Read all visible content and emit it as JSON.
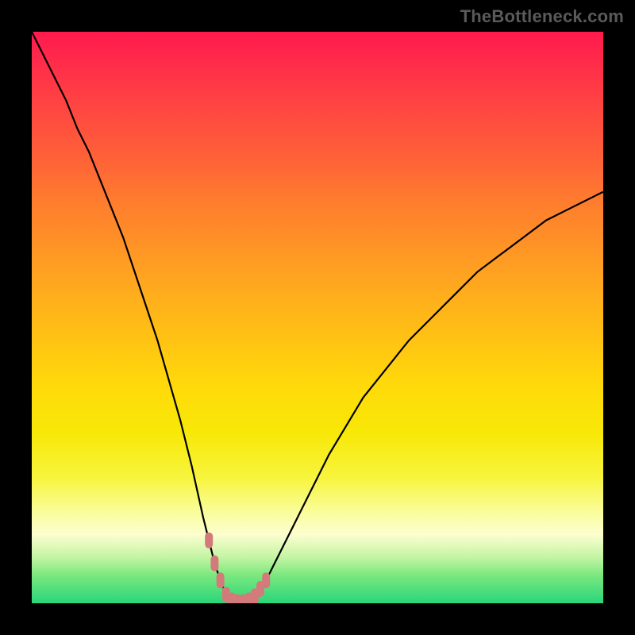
{
  "watermark": "TheBottleneck.com",
  "chart_data": {
    "type": "line",
    "title": "",
    "xlabel": "",
    "ylabel": "",
    "xlim": [
      0,
      100
    ],
    "ylim": [
      0,
      100
    ],
    "description": "Bottleneck percentage curve with a V-shaped minimum near x≈36, on a rainbow gradient (red=high bottleneck at top, green=low at bottom).",
    "series": [
      {
        "name": "bottleneck-curve",
        "x": [
          0,
          2,
          4,
          6,
          8,
          10,
          12,
          14,
          16,
          18,
          20,
          22,
          24,
          26,
          28,
          30,
          31,
          32,
          33,
          34,
          35,
          36,
          37,
          38,
          39,
          40,
          41,
          42,
          44,
          46,
          48,
          50,
          52,
          55,
          58,
          62,
          66,
          70,
          74,
          78,
          82,
          86,
          90,
          94,
          98,
          100
        ],
        "y": [
          100,
          96,
          92,
          88,
          83,
          79,
          74,
          69,
          64,
          58,
          52,
          46,
          39,
          32,
          24,
          15,
          11,
          7,
          4,
          1.5,
          0.5,
          0.2,
          0.2,
          0.5,
          1.2,
          2.5,
          4,
          6,
          10,
          14,
          18,
          22,
          26,
          31,
          36,
          41,
          46,
          50,
          54,
          58,
          61,
          64,
          67,
          69,
          71,
          72
        ]
      }
    ],
    "markers": {
      "name": "highlight-points",
      "x": [
        31,
        32,
        33,
        34,
        35,
        36,
        37,
        38,
        39,
        40,
        41
      ],
      "y": [
        11,
        7,
        4,
        1.5,
        0.5,
        0.2,
        0.2,
        0.5,
        1.2,
        2.5,
        4
      ]
    },
    "gradient_stops": [
      {
        "offset": 0.0,
        "color": "#ff1a4d"
      },
      {
        "offset": 0.5,
        "color": "#ffc018"
      },
      {
        "offset": 0.85,
        "color": "#fbfea0"
      },
      {
        "offset": 1.0,
        "color": "#28d67a"
      }
    ]
  }
}
